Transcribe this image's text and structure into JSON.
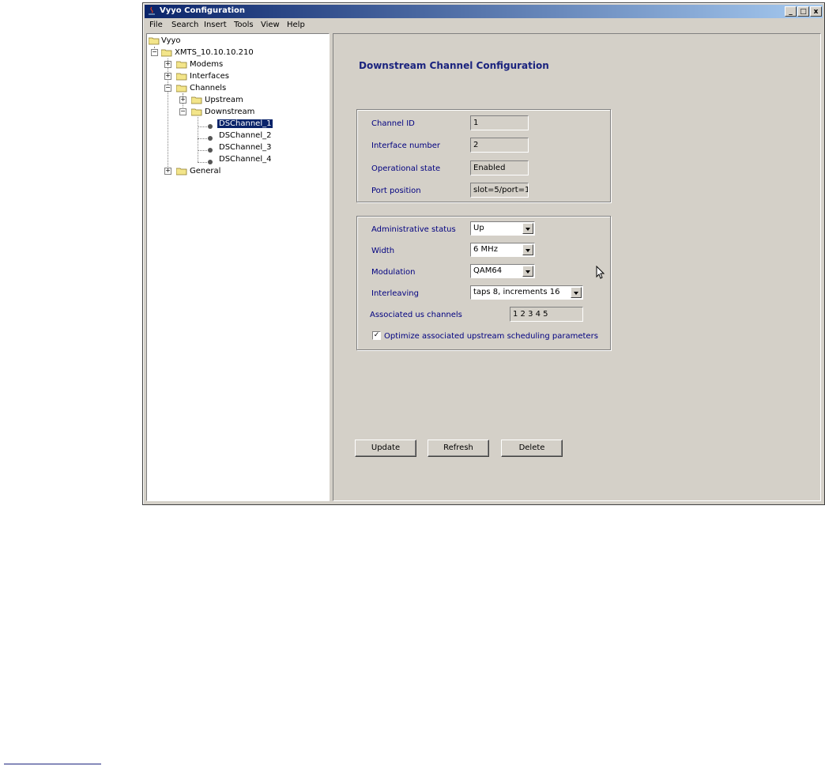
{
  "window": {
    "title": "Vyyo Configuration",
    "minimize": "_",
    "maximize": "□",
    "close": "x"
  },
  "menu": [
    "File",
    "Search",
    "Insert",
    "Tools",
    "View",
    "Help"
  ],
  "tree": {
    "root": "Vyyo",
    "xmts": "XMTS_10.10.10.210",
    "modems": "Modems",
    "interfaces": "Interfaces",
    "channels": "Channels",
    "upstream": "Upstream",
    "downstream": "Downstream",
    "ds_channels": [
      "DSChannel_1",
      "DSChannel_2",
      "DSChannel_3",
      "DSChannel_4"
    ],
    "general": "General",
    "expand_plus": "+",
    "expand_minus": "−"
  },
  "panel": {
    "heading": "Downstream Channel Configuration",
    "info": {
      "channel_id_label": "Channel ID",
      "channel_id": "1",
      "interface_number_label": "Interface number",
      "interface_number": "2",
      "operational_state_label": "Operational state",
      "operational_state": "Enabled",
      "port_position_label": "Port position",
      "port_position": "slot=5/port=1"
    },
    "settings": {
      "admin_status_label": "Administrative status",
      "admin_status": "Up",
      "width_label": "Width",
      "width": "6 MHz",
      "modulation_label": "Modulation",
      "modulation": "QAM64",
      "interleaving_label": "Interleaving",
      "interleaving": "taps 8, increments 16",
      "assoc_us_label": "Associated us channels",
      "assoc_us": "1 2 3 4 5",
      "optimize_label": "Optimize associated upstream scheduling parameters",
      "optimize_checked": true,
      "check_mark": "✓"
    },
    "buttons": {
      "update": "Update",
      "refresh": "Refresh",
      "delete": "Delete"
    }
  }
}
